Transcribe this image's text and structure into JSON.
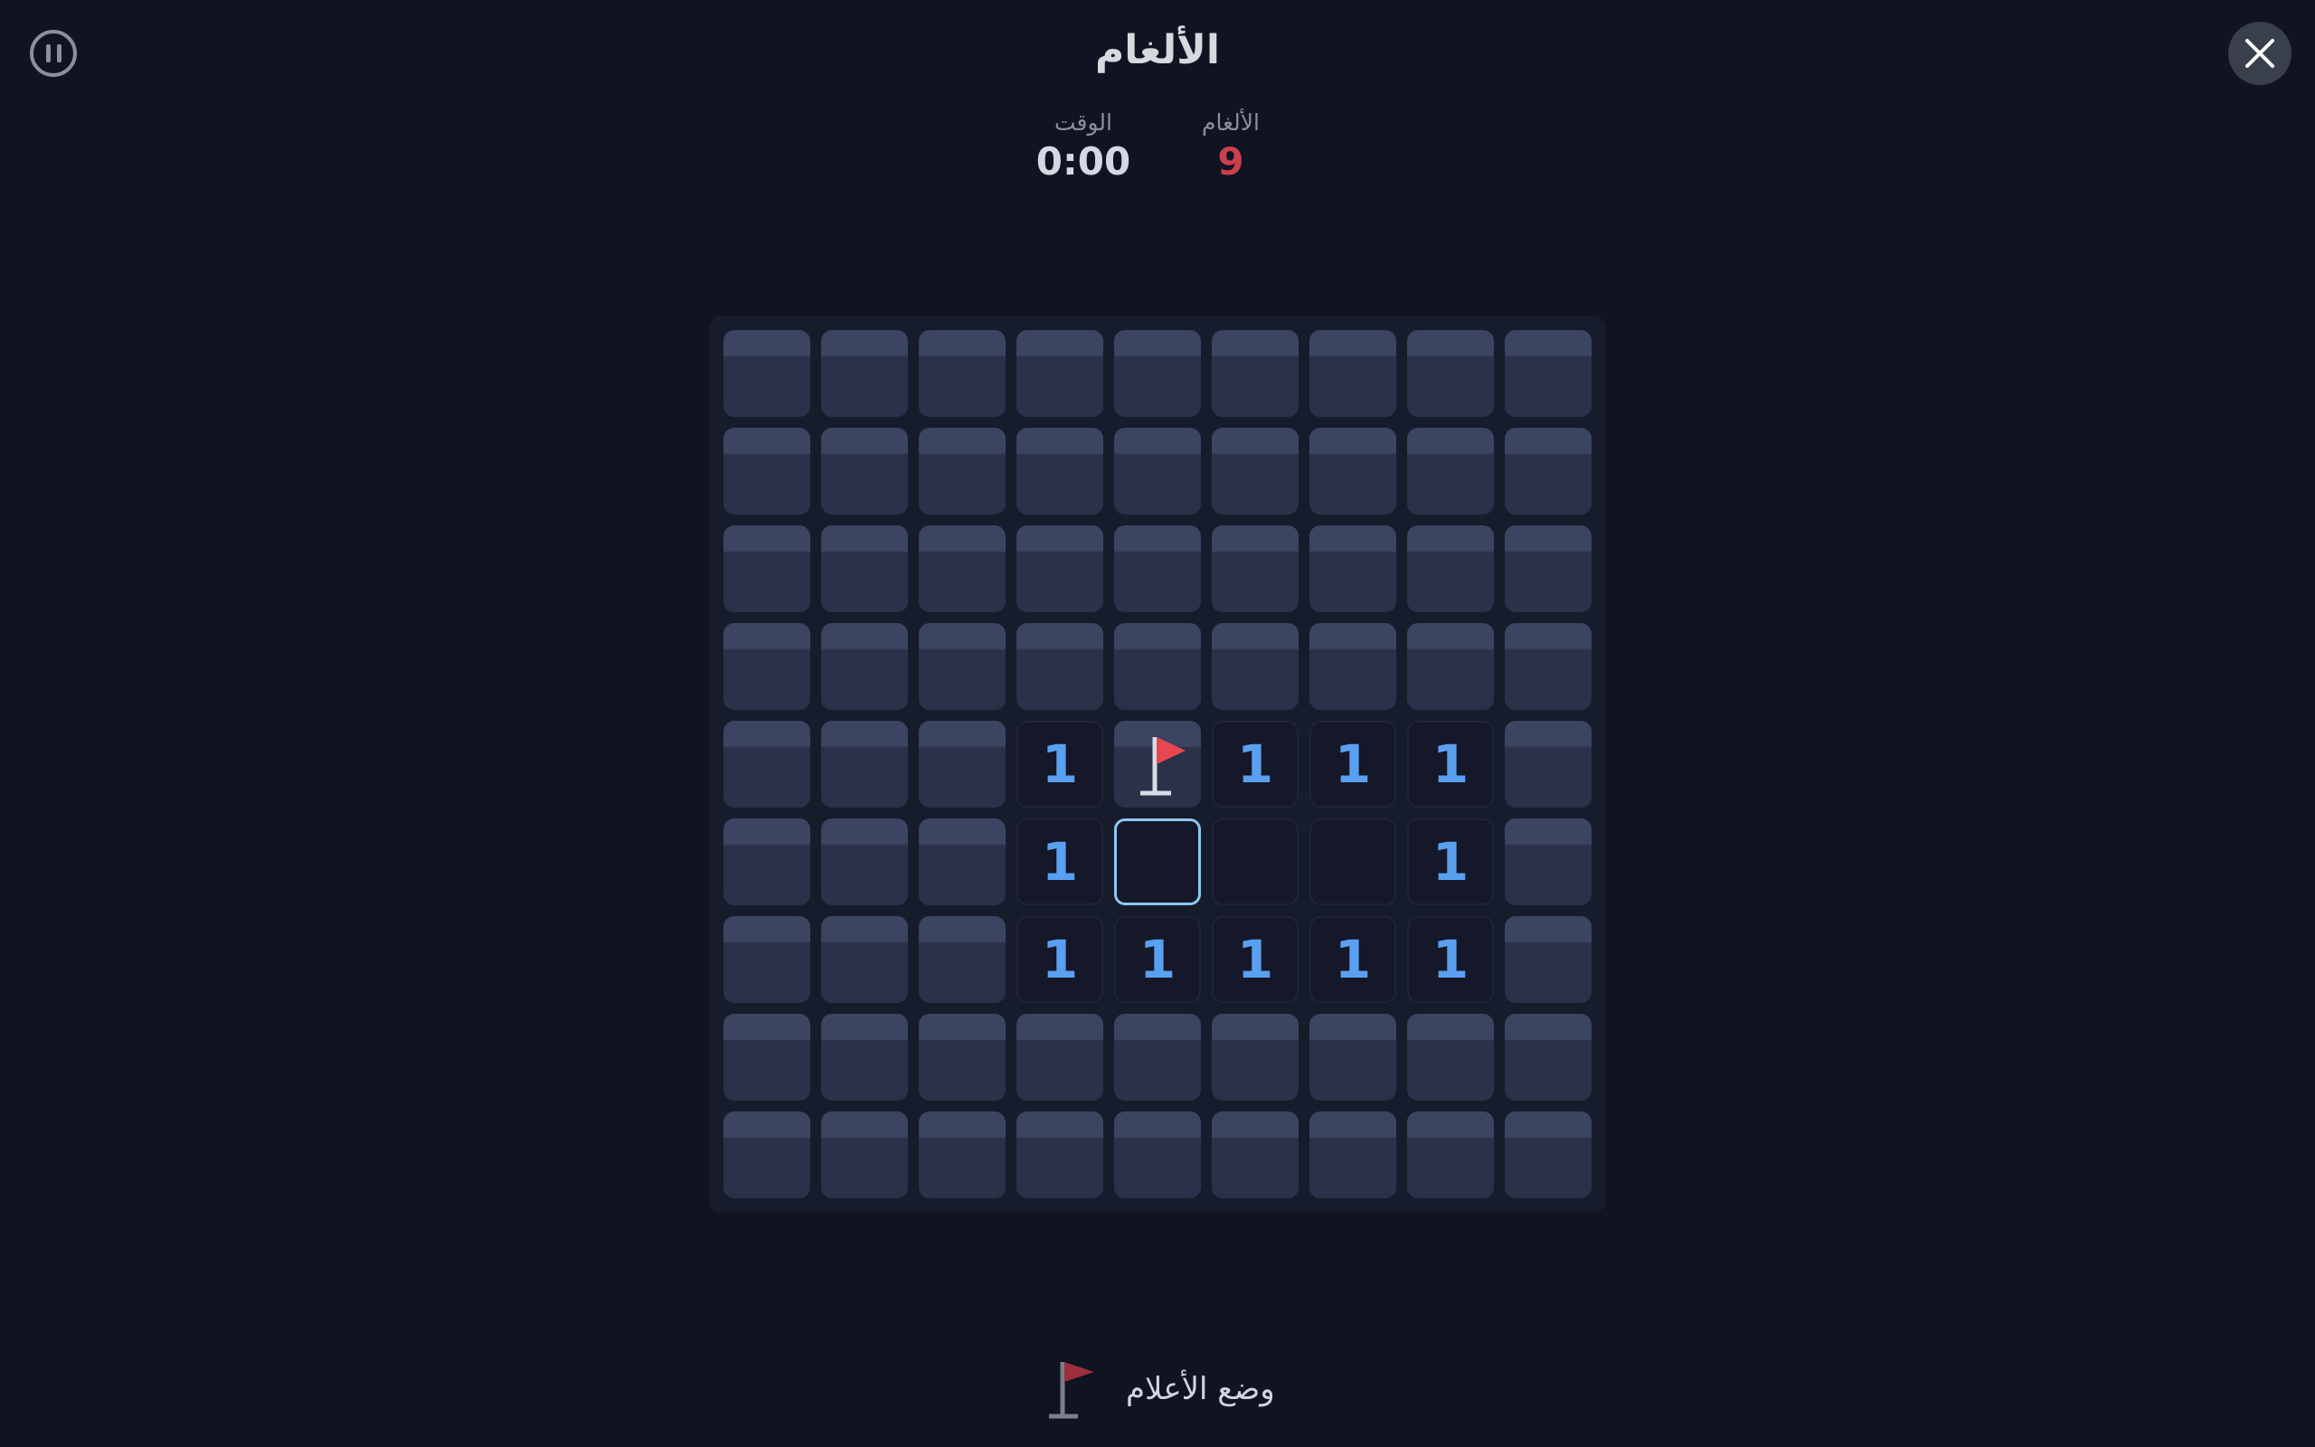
{
  "header": {
    "title": "الألغام"
  },
  "stats": {
    "time_label": "الوقت",
    "time_value": "0:00",
    "mines_label": "الألغام",
    "mines_value": "9"
  },
  "board": {
    "rows": 9,
    "cols": 9,
    "selected": [
      5,
      4
    ],
    "cells": [
      [
        "c",
        "c",
        "c",
        "c",
        "c",
        "c",
        "c",
        "c",
        "c"
      ],
      [
        "c",
        "c",
        "c",
        "c",
        "c",
        "c",
        "c",
        "c",
        "c"
      ],
      [
        "c",
        "c",
        "c",
        "c",
        "c",
        "c",
        "c",
        "c",
        "c"
      ],
      [
        "c",
        "c",
        "c",
        "c",
        "c",
        "c",
        "c",
        "c",
        "c"
      ],
      [
        "c",
        "c",
        "c",
        "1",
        "f",
        "1",
        "1",
        "1",
        "c"
      ],
      [
        "c",
        "c",
        "c",
        "1",
        "0",
        "0",
        "0",
        "1",
        "c"
      ],
      [
        "c",
        "c",
        "c",
        "1",
        "1",
        "1",
        "1",
        "1",
        "c"
      ],
      [
        "c",
        "c",
        "c",
        "c",
        "c",
        "c",
        "c",
        "c",
        "c"
      ],
      [
        "c",
        "c",
        "c",
        "c",
        "c",
        "c",
        "c",
        "c",
        "c"
      ]
    ]
  },
  "footer": {
    "flag_mode_label": "وضع الأعلام"
  },
  "icons": {
    "pause": "pause-icon",
    "close": "close-icon",
    "flag": "flag-icon",
    "flag_mode": "flag-icon"
  },
  "colors": {
    "background": "#0f1322",
    "covered_cell": "#2a3148",
    "number": "#5aa0f0",
    "mines_count": "#c8404c",
    "flag": "#e8474f",
    "selected_border": "#8fc6f0"
  }
}
